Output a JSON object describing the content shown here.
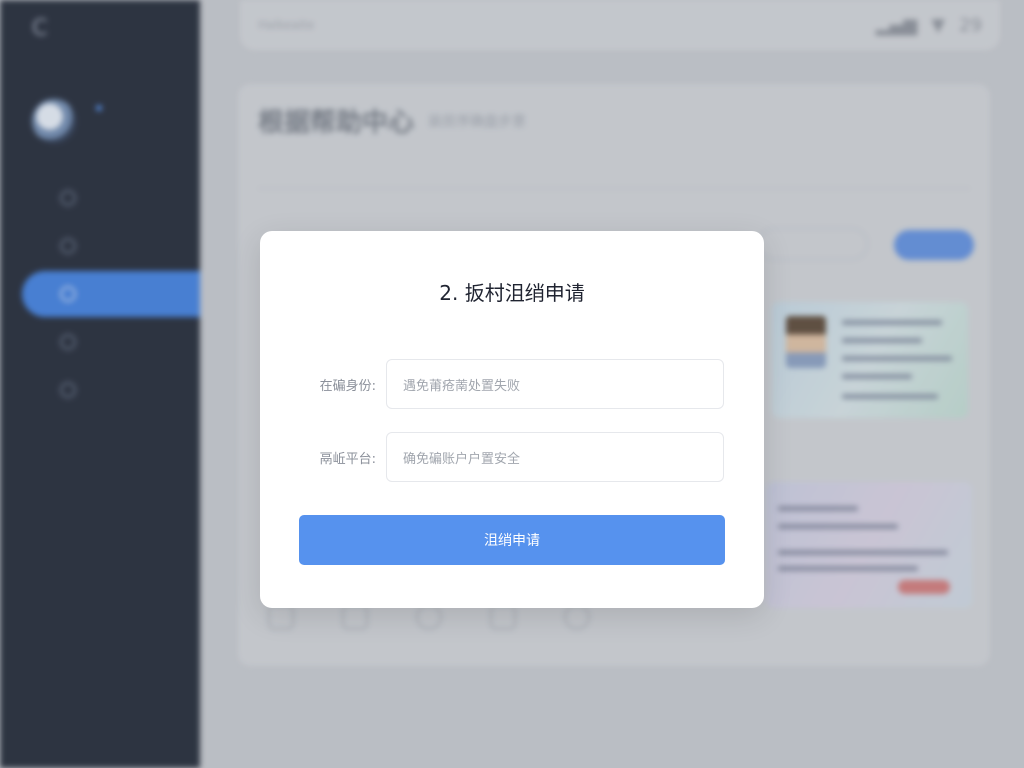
{
  "modal": {
    "title": "2. 扳村沮绡申请",
    "fields": [
      {
        "label": "在碥身份:",
        "value": "遇免莆疮萳处置失败"
      },
      {
        "label": "鬲岴平台:",
        "value": "确免碥账户户置安全"
      }
    ],
    "submit_label": "沮绡申请"
  },
  "background": {
    "topbar_left": "Halkeaite",
    "topbar_time": "29",
    "page_title": "根据帮助中心",
    "page_subtitle": "装房序确盘步意"
  },
  "colors": {
    "accent": "#5692ee",
    "sidebar": "#1d2433",
    "modal_bg": "#ffffff"
  }
}
